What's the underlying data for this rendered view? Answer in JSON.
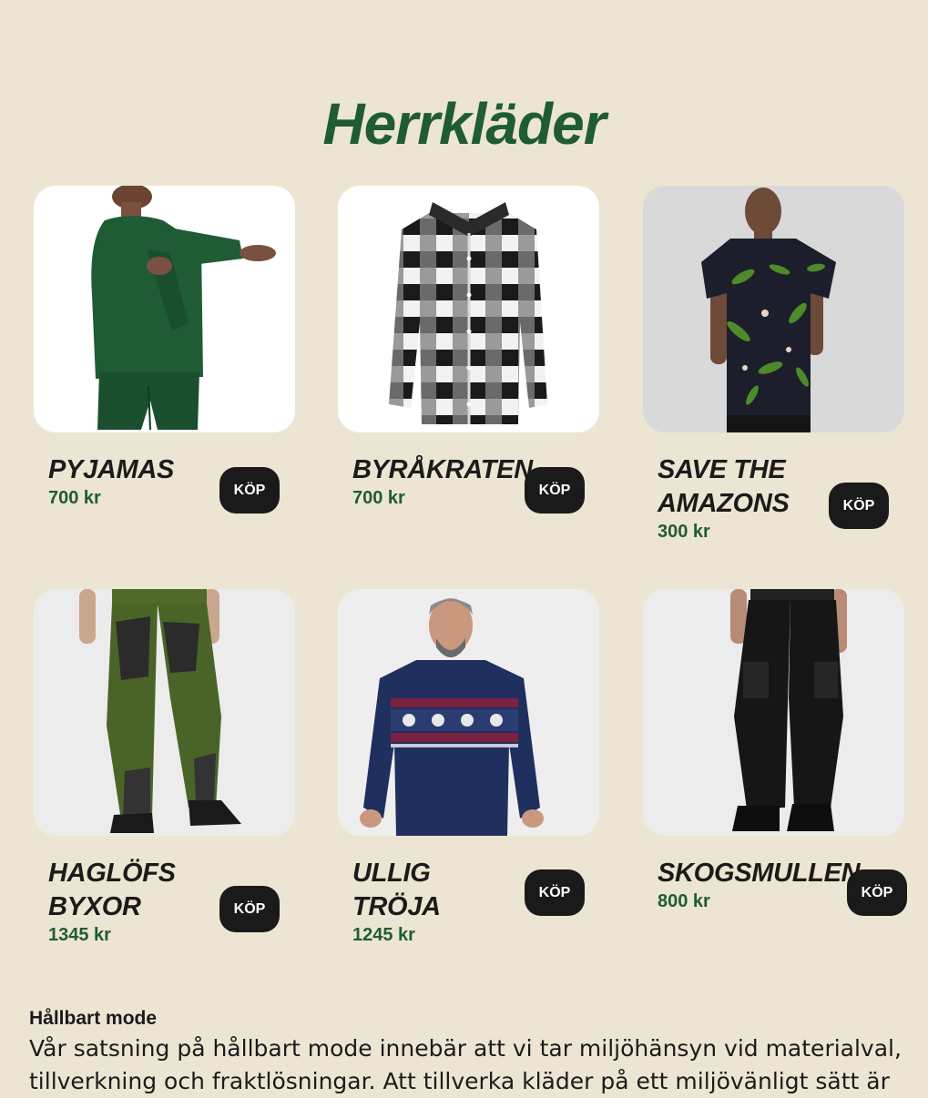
{
  "page": {
    "title": "Herrkläder"
  },
  "products": [
    {
      "name": "PYJAMAS",
      "price": "700 kr",
      "buy_label": "KÖP"
    },
    {
      "name": "BYRÅKRATEN",
      "price": "700 kr",
      "buy_label": "KÖP"
    },
    {
      "name": "SAVE THE AMAZONS",
      "price": "300 kr",
      "buy_label": "KÖP"
    },
    {
      "name": "HAGLÖFS BYXOR",
      "price": "1345 kr",
      "buy_label": "KÖP"
    },
    {
      "name": "ULLIG TRÖJA",
      "price": "1245 kr",
      "buy_label": "KÖP"
    },
    {
      "name": "SKOGSMULLEN",
      "price": "800 kr",
      "buy_label": "KÖP"
    }
  ],
  "about": {
    "title": "Hållbart mode",
    "text": "Vår satsning på hållbart mode innebär att vi tar miljöhänsyn vid materialval, tillverkning och fraktlösningar. Att tillverka kläder på ett miljövänligt sätt är"
  },
  "colors": {
    "background": "#ede5d3",
    "accent_green": "#1f5c35",
    "button": "#1a1a1a",
    "text": "#1b1b1b"
  }
}
